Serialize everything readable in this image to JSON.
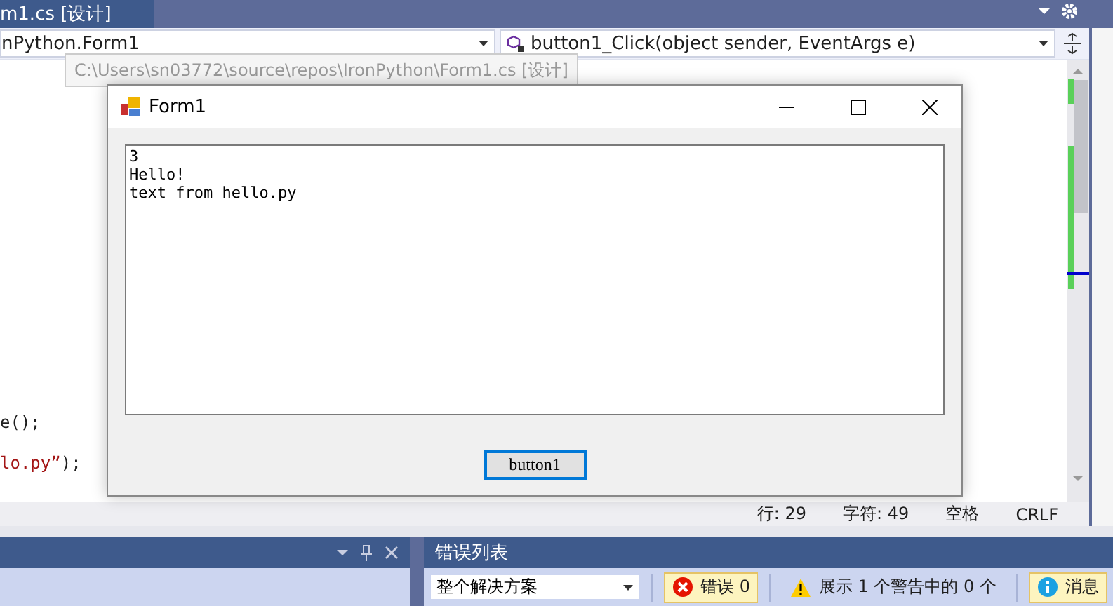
{
  "document_tab": {
    "label": "m1.cs [设计]",
    "selected": true
  },
  "nav": {
    "type_dropdown": "nPython.Form1",
    "member_dropdown": "button1_Click(object sender, EventArgs e)"
  },
  "tooltip": "C:\\Users\\sn03772\\source\\repos\\IronPython\\Form1.cs [设计]",
  "code_lines": [
    {
      "parts": [
        {
          "kind": "code",
          "text": "e();"
        }
      ]
    },
    {
      "parts": [
        {
          "kind": "string",
          "text": "lo.py”"
        },
        {
          "kind": "code",
          "text": ");"
        }
      ]
    }
  ],
  "status": {
    "line": "行: 29",
    "char": "字符: 49",
    "indent": "空格",
    "eol": "CRLF"
  },
  "form": {
    "title": "Form1",
    "text_lines": [
      "3",
      "Hello!",
      "text from hello.py"
    ],
    "button": {
      "label": "button1",
      "focused": true
    }
  },
  "error_list": {
    "title": "错误列表",
    "scope": "整个解决方案",
    "filters": [
      {
        "kind": "error",
        "label": "错误 0",
        "selected": true
      },
      {
        "kind": "warning",
        "label": "展示 1 个警告中的 0 个",
        "selected": false
      },
      {
        "kind": "info",
        "label": "消息",
        "selected": true
      }
    ]
  }
}
